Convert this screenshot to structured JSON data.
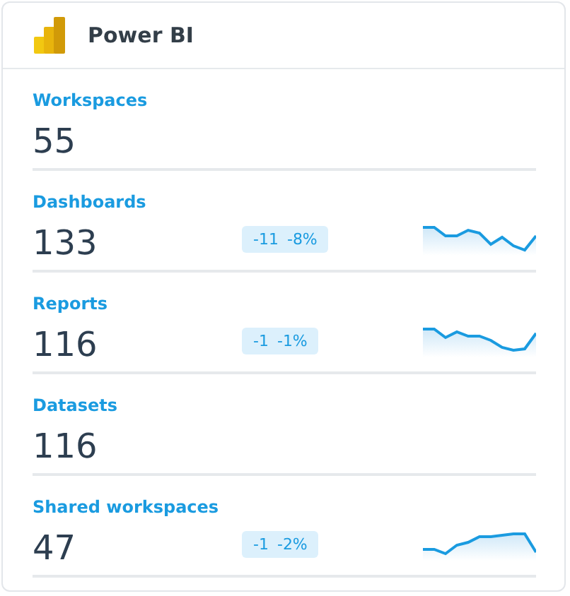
{
  "header": {
    "title": "Power BI"
  },
  "metrics": [
    {
      "label": "Workspaces",
      "value": "55"
    },
    {
      "label": "Dashboards",
      "value": "133",
      "change": {
        "count": "-11",
        "percent": "-8%"
      },
      "sparkline": true
    },
    {
      "label": "Reports",
      "value": "116",
      "change": {
        "count": "-1",
        "percent": "-1%"
      },
      "sparkline": true
    },
    {
      "label": "Datasets",
      "value": "116"
    },
    {
      "label": "Shared workspaces",
      "value": "47",
      "change": {
        "count": "-1",
        "percent": "-2%"
      },
      "sparkline": true
    }
  ]
}
